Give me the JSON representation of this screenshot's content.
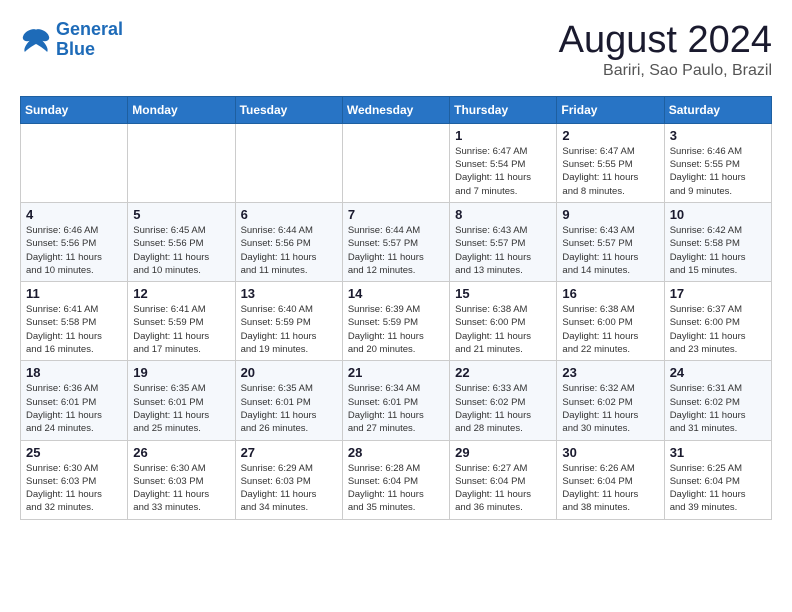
{
  "logo": {
    "line1": "General",
    "line2": "Blue"
  },
  "title": "August 2024",
  "location": "Bariri, Sao Paulo, Brazil",
  "days_of_week": [
    "Sunday",
    "Monday",
    "Tuesday",
    "Wednesday",
    "Thursday",
    "Friday",
    "Saturday"
  ],
  "weeks": [
    [
      {
        "day": "",
        "info": ""
      },
      {
        "day": "",
        "info": ""
      },
      {
        "day": "",
        "info": ""
      },
      {
        "day": "",
        "info": ""
      },
      {
        "day": "1",
        "info": "Sunrise: 6:47 AM\nSunset: 5:54 PM\nDaylight: 11 hours\nand 7 minutes."
      },
      {
        "day": "2",
        "info": "Sunrise: 6:47 AM\nSunset: 5:55 PM\nDaylight: 11 hours\nand 8 minutes."
      },
      {
        "day": "3",
        "info": "Sunrise: 6:46 AM\nSunset: 5:55 PM\nDaylight: 11 hours\nand 9 minutes."
      }
    ],
    [
      {
        "day": "4",
        "info": "Sunrise: 6:46 AM\nSunset: 5:56 PM\nDaylight: 11 hours\nand 10 minutes."
      },
      {
        "day": "5",
        "info": "Sunrise: 6:45 AM\nSunset: 5:56 PM\nDaylight: 11 hours\nand 10 minutes."
      },
      {
        "day": "6",
        "info": "Sunrise: 6:44 AM\nSunset: 5:56 PM\nDaylight: 11 hours\nand 11 minutes."
      },
      {
        "day": "7",
        "info": "Sunrise: 6:44 AM\nSunset: 5:57 PM\nDaylight: 11 hours\nand 12 minutes."
      },
      {
        "day": "8",
        "info": "Sunrise: 6:43 AM\nSunset: 5:57 PM\nDaylight: 11 hours\nand 13 minutes."
      },
      {
        "day": "9",
        "info": "Sunrise: 6:43 AM\nSunset: 5:57 PM\nDaylight: 11 hours\nand 14 minutes."
      },
      {
        "day": "10",
        "info": "Sunrise: 6:42 AM\nSunset: 5:58 PM\nDaylight: 11 hours\nand 15 minutes."
      }
    ],
    [
      {
        "day": "11",
        "info": "Sunrise: 6:41 AM\nSunset: 5:58 PM\nDaylight: 11 hours\nand 16 minutes."
      },
      {
        "day": "12",
        "info": "Sunrise: 6:41 AM\nSunset: 5:59 PM\nDaylight: 11 hours\nand 17 minutes."
      },
      {
        "day": "13",
        "info": "Sunrise: 6:40 AM\nSunset: 5:59 PM\nDaylight: 11 hours\nand 19 minutes."
      },
      {
        "day": "14",
        "info": "Sunrise: 6:39 AM\nSunset: 5:59 PM\nDaylight: 11 hours\nand 20 minutes."
      },
      {
        "day": "15",
        "info": "Sunrise: 6:38 AM\nSunset: 6:00 PM\nDaylight: 11 hours\nand 21 minutes."
      },
      {
        "day": "16",
        "info": "Sunrise: 6:38 AM\nSunset: 6:00 PM\nDaylight: 11 hours\nand 22 minutes."
      },
      {
        "day": "17",
        "info": "Sunrise: 6:37 AM\nSunset: 6:00 PM\nDaylight: 11 hours\nand 23 minutes."
      }
    ],
    [
      {
        "day": "18",
        "info": "Sunrise: 6:36 AM\nSunset: 6:01 PM\nDaylight: 11 hours\nand 24 minutes."
      },
      {
        "day": "19",
        "info": "Sunrise: 6:35 AM\nSunset: 6:01 PM\nDaylight: 11 hours\nand 25 minutes."
      },
      {
        "day": "20",
        "info": "Sunrise: 6:35 AM\nSunset: 6:01 PM\nDaylight: 11 hours\nand 26 minutes."
      },
      {
        "day": "21",
        "info": "Sunrise: 6:34 AM\nSunset: 6:01 PM\nDaylight: 11 hours\nand 27 minutes."
      },
      {
        "day": "22",
        "info": "Sunrise: 6:33 AM\nSunset: 6:02 PM\nDaylight: 11 hours\nand 28 minutes."
      },
      {
        "day": "23",
        "info": "Sunrise: 6:32 AM\nSunset: 6:02 PM\nDaylight: 11 hours\nand 30 minutes."
      },
      {
        "day": "24",
        "info": "Sunrise: 6:31 AM\nSunset: 6:02 PM\nDaylight: 11 hours\nand 31 minutes."
      }
    ],
    [
      {
        "day": "25",
        "info": "Sunrise: 6:30 AM\nSunset: 6:03 PM\nDaylight: 11 hours\nand 32 minutes."
      },
      {
        "day": "26",
        "info": "Sunrise: 6:30 AM\nSunset: 6:03 PM\nDaylight: 11 hours\nand 33 minutes."
      },
      {
        "day": "27",
        "info": "Sunrise: 6:29 AM\nSunset: 6:03 PM\nDaylight: 11 hours\nand 34 minutes."
      },
      {
        "day": "28",
        "info": "Sunrise: 6:28 AM\nSunset: 6:04 PM\nDaylight: 11 hours\nand 35 minutes."
      },
      {
        "day": "29",
        "info": "Sunrise: 6:27 AM\nSunset: 6:04 PM\nDaylight: 11 hours\nand 36 minutes."
      },
      {
        "day": "30",
        "info": "Sunrise: 6:26 AM\nSunset: 6:04 PM\nDaylight: 11 hours\nand 38 minutes."
      },
      {
        "day": "31",
        "info": "Sunrise: 6:25 AM\nSunset: 6:04 PM\nDaylight: 11 hours\nand 39 minutes."
      }
    ]
  ]
}
